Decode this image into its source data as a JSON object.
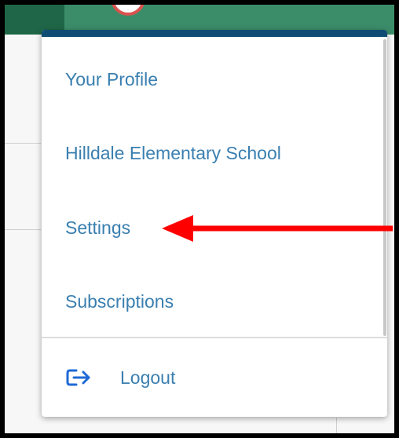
{
  "menu": {
    "items": [
      {
        "label": "Your Profile"
      },
      {
        "label": "Hilldale Elementary School"
      },
      {
        "label": "Settings"
      },
      {
        "label": "Subscriptions"
      }
    ],
    "logout_label": "Logout"
  },
  "icons": {
    "logout": "logout-arrow-icon",
    "annotation": "red-arrow-pointer"
  },
  "colors": {
    "topbar": "#3b8d6a",
    "topbar_dark": "#1f6648",
    "dropdown_accent": "#0e4c73",
    "menu_text": "#3a7fb0",
    "logout_icon": "#1f6ad6",
    "annotation_arrow": "#ff0000"
  }
}
